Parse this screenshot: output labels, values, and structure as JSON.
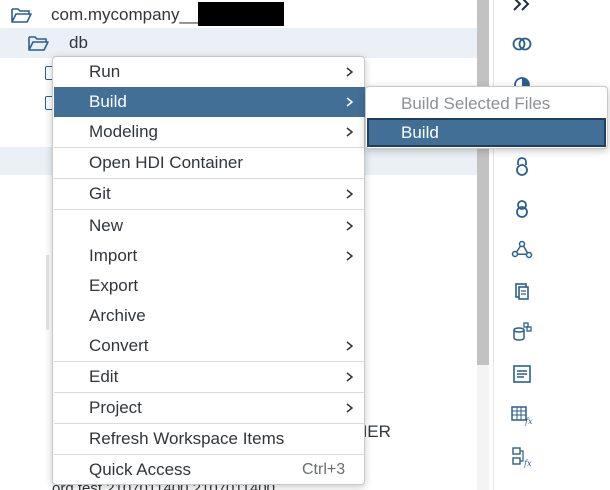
{
  "tree": {
    "root_label": "com.mycompany__",
    "db_label": "db",
    "partial_text": "NER",
    "partial_text_bottom": "ord test 2107011400    2107011400"
  },
  "toolbar": {
    "icons": [
      "double-chevron-right-icon",
      "link-rings-icon",
      "half-circle-icon",
      "lock-icon",
      "lock-icon",
      "graph-nodes-icon",
      "documents-icon",
      "database-add-icon",
      "text-document-icon",
      "table-function-icon",
      "hierarchy-function-icon",
      "partial-icon"
    ]
  },
  "context_menu": {
    "items": [
      {
        "label": "Run",
        "submenu": true
      },
      {
        "label": "Build",
        "submenu": true,
        "active": true
      },
      {
        "label": "Modeling",
        "submenu": true
      },
      {
        "label": "Open HDI Container",
        "submenu": false
      },
      {
        "label": "Git",
        "submenu": true
      },
      {
        "label": "New",
        "submenu": true
      },
      {
        "label": "Import",
        "submenu": true
      },
      {
        "label": "Export",
        "submenu": false
      },
      {
        "label": "Archive",
        "submenu": false
      },
      {
        "label": "Convert",
        "submenu": true
      },
      {
        "label": "Edit",
        "submenu": true
      },
      {
        "label": "Project",
        "submenu": true
      },
      {
        "label": "Refresh Workspace Items",
        "submenu": false
      },
      {
        "label": "Quick Access",
        "submenu": false,
        "shortcut": "Ctrl+3"
      }
    ]
  },
  "build_submenu": {
    "items": [
      {
        "label": "Build Selected Files",
        "disabled": true
      },
      {
        "label": "Build",
        "selected": true
      }
    ]
  },
  "colors": {
    "accent": "#426f96",
    "icon_blue": "#2b5f8f",
    "row_highlight": "#eaf0f6",
    "disabled_text": "#8c9196"
  }
}
